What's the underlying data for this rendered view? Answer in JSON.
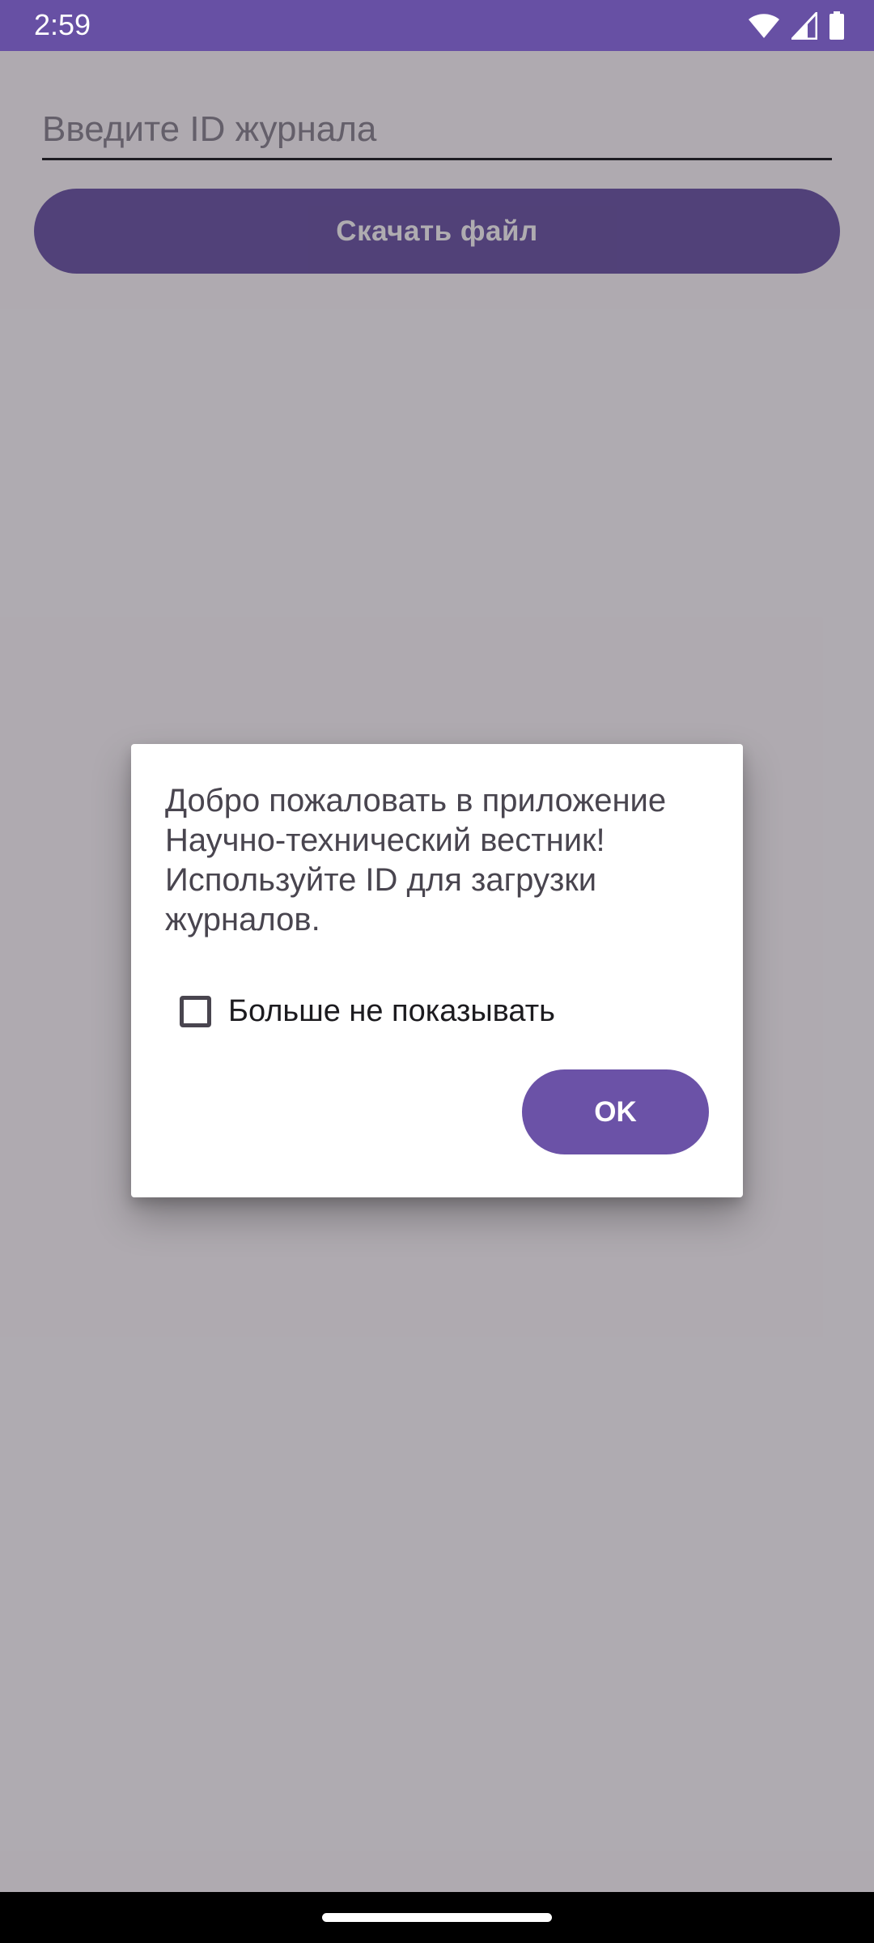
{
  "status_bar": {
    "time": "2:59",
    "icons": [
      "wifi-icon",
      "signal-icon",
      "battery-icon"
    ]
  },
  "form": {
    "journal_id_placeholder": "Введите ID журнала",
    "journal_id_value": "",
    "download_button_label": "Скачать файл"
  },
  "dialog": {
    "message": "Добро пожаловать в приложение Научно-технический вестник! Используйте ID для загрузки журналов.",
    "checkbox_label": "Больше не показывать",
    "checkbox_checked": false,
    "ok_button_label": "OK"
  },
  "colors": {
    "primary": "#6750a4",
    "scrim": "#211d28",
    "dialog_background": "#ffffff",
    "text_secondary": "#49454f"
  }
}
